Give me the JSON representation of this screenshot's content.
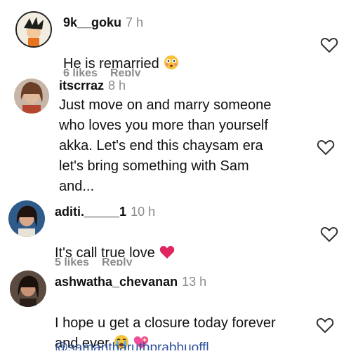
{
  "comments": [
    {
      "username": "9k__goku",
      "time": "7 h",
      "text": "He is remarried",
      "likes": "6 likes",
      "reply": "Reply"
    },
    {
      "username": "itscrraz",
      "time": "8 h",
      "text": "Just move on and marry someone\nwho loves you more than yourself\nakka. Let's end this chaysam era\nlet's bring something with Sam\nand...",
      "likes": "",
      "reply": ""
    },
    {
      "username": "aditi._____1",
      "time": "10 h",
      "text": "It's call true love",
      "likes": "5 likes",
      "reply": "Reply"
    },
    {
      "username": "ashwatha_chevanan",
      "time": "13 h",
      "text": "I hope u get a closure today forever\nand ever",
      "mention": "@samantharuthprabhuoffl"
    }
  ],
  "icons": {
    "like": "heart-outline-icon",
    "flushed": "flushed-face-emoji",
    "red_heart": "red-heart-emoji",
    "crying": "loudly-crying-face-emoji",
    "sparkle_heart": "sparkling-heart-emoji"
  },
  "colors": {
    "time": "#8a8a8a",
    "mention": "#2b4f9c",
    "heart": "#e0245e"
  }
}
